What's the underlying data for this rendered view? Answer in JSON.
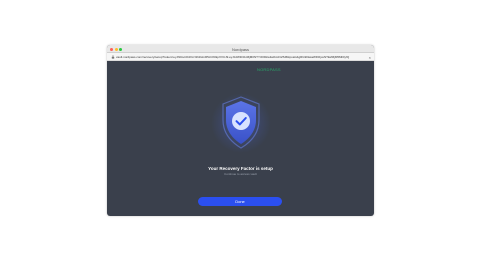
{
  "window": {
    "title": "Nordpass",
    "url": "vault.nordpass.com/recovery/setup?token=eyJhbGciOiJIUzI1NiIsInR5cCI6IkpXVCJ9.eyJzdWIiOiIxMjM0NTY3ODkwIiwibmFtZSI6IkpvaG4gRG9lIiwiaWF0IjoxNTE2MjM5MDIyfQ"
  },
  "header": {
    "link": "NORDPASS"
  },
  "main": {
    "heading": "Your Recovery Factor is setup",
    "subtext": "Continue to access vault",
    "done_label": "Done"
  },
  "colors": {
    "background": "#3a404c",
    "accent": "#2b4ff0",
    "shield": "#4a6cf7",
    "link": "#2aa86a"
  },
  "icons": {
    "shield": "shield-check-icon",
    "lock": "lock-icon",
    "close": "close-icon"
  }
}
